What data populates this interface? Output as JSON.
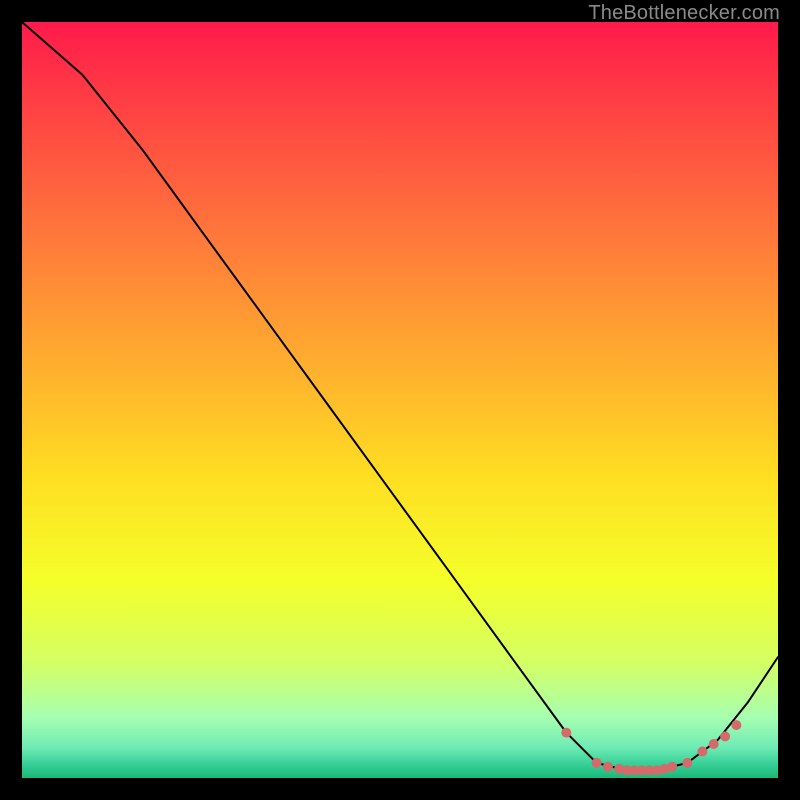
{
  "watermark": "TheBottlenecker.com",
  "chart_data": {
    "type": "line",
    "title": "",
    "xlabel": "",
    "ylabel": "",
    "xlim": [
      0,
      100
    ],
    "ylim": [
      0,
      100
    ],
    "grid": false,
    "gradient_stops": [
      {
        "pct": 0,
        "color": "#ff1a4b"
      },
      {
        "pct": 14,
        "color": "#ff4a42"
      },
      {
        "pct": 30,
        "color": "#ff7d3a"
      },
      {
        "pct": 46,
        "color": "#ffb02e"
      },
      {
        "pct": 60,
        "color": "#ffde22"
      },
      {
        "pct": 74,
        "color": "#f4ff2a"
      },
      {
        "pct": 85,
        "color": "#d3ff66"
      },
      {
        "pct": 92,
        "color": "#a6ffb0"
      },
      {
        "pct": 96,
        "color": "#6eebb4"
      },
      {
        "pct": 98,
        "color": "#3ad29a"
      },
      {
        "pct": 100,
        "color": "#1ab87a"
      }
    ],
    "series": [
      {
        "name": "bottleneck-curve",
        "stroke": "#000000",
        "stroke_width": 2,
        "x": [
          0,
          8,
          16,
          24,
          32,
          40,
          48,
          56,
          64,
          72,
          76,
          80,
          84,
          88,
          92,
          96,
          100
        ],
        "y": [
          100,
          93,
          83,
          72,
          61,
          50,
          39,
          28,
          17,
          6,
          2,
          1,
          1,
          2,
          5,
          10,
          16
        ]
      }
    ],
    "markers": {
      "name": "optimal-range-dots",
      "color": "#d46a6a",
      "radius": 5,
      "x": [
        72,
        76,
        77.5,
        79,
        80,
        81,
        82,
        83,
        84,
        85,
        86,
        88,
        90,
        91.5,
        93,
        94.5
      ],
      "y": [
        6,
        2,
        1.5,
        1.2,
        1,
        1,
        1,
        1,
        1,
        1.2,
        1.5,
        2,
        3.5,
        4.5,
        5.5,
        7
      ]
    }
  }
}
